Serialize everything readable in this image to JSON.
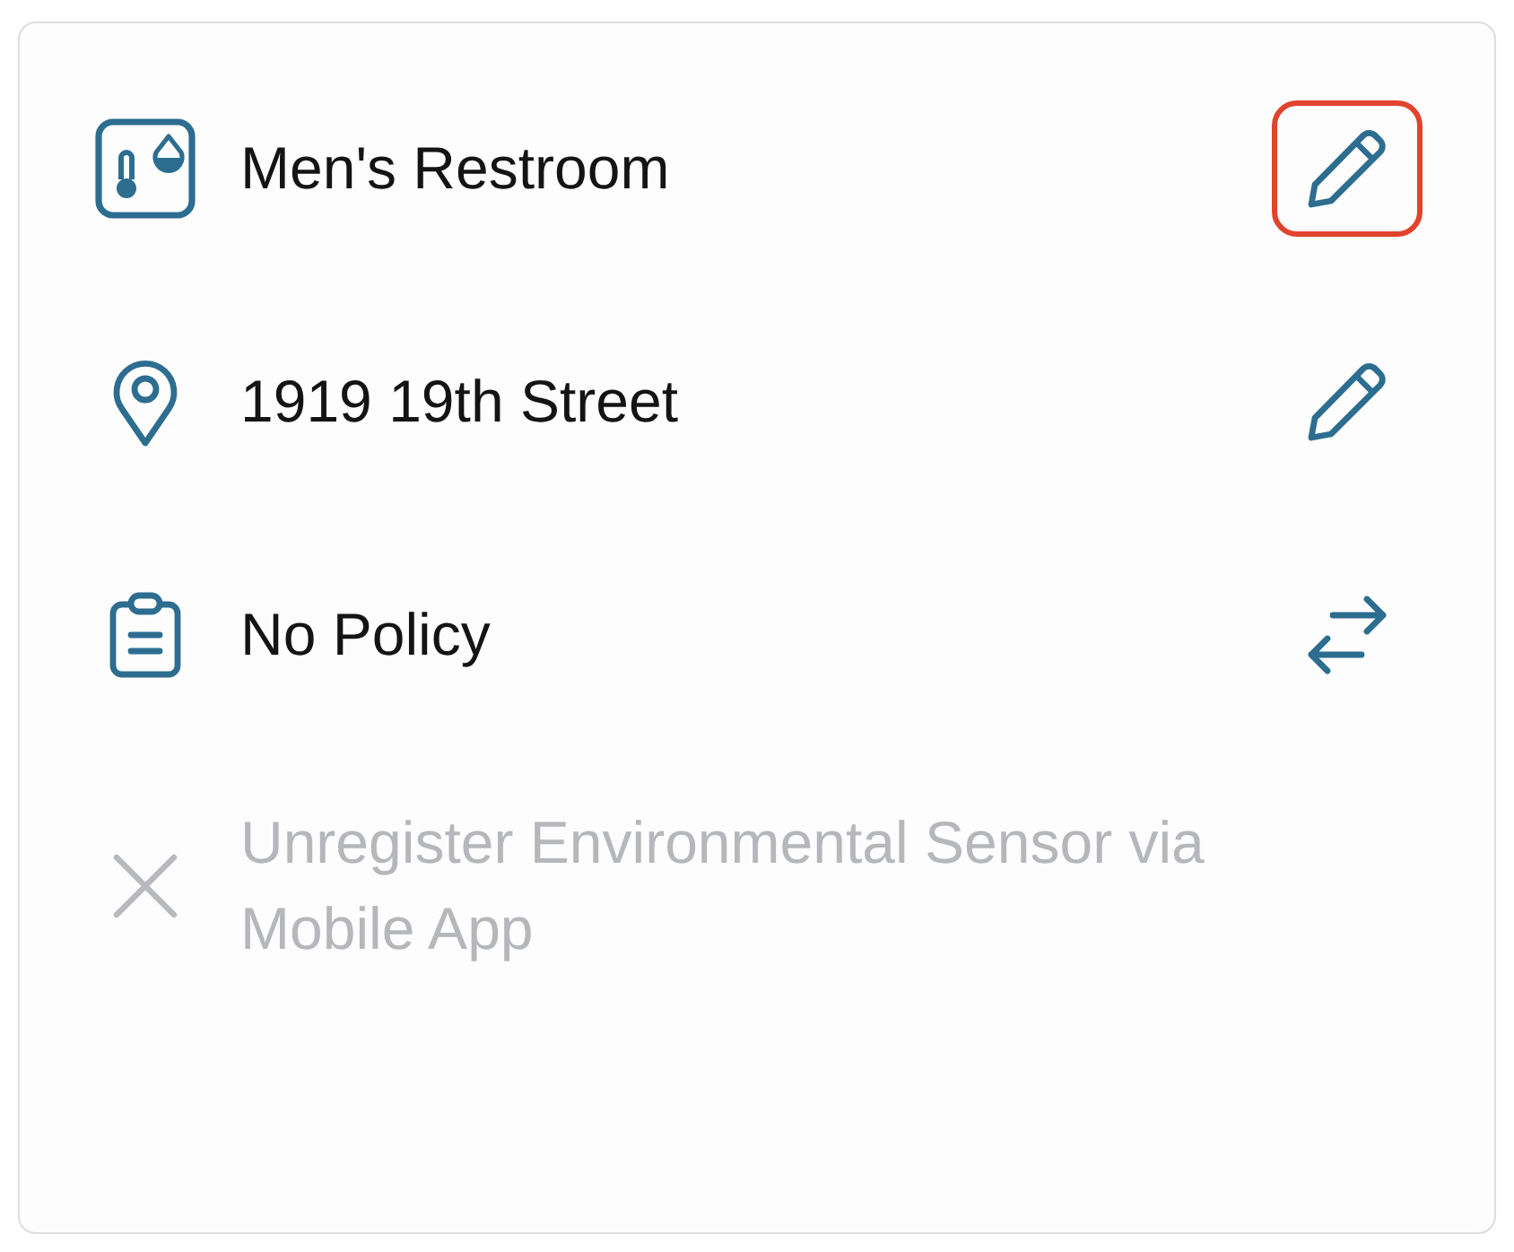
{
  "card": {
    "rows": [
      {
        "kind": "sensor",
        "label": "Men's Restroom",
        "disabled": false,
        "action": {
          "kind": "edit",
          "highlighted": true
        }
      },
      {
        "kind": "location",
        "label": "1919 19th Street",
        "disabled": false,
        "action": {
          "kind": "edit",
          "highlighted": false
        }
      },
      {
        "kind": "policy",
        "label": "No Policy",
        "disabled": false,
        "action": {
          "kind": "swap",
          "highlighted": false
        }
      },
      {
        "kind": "unregister",
        "label": "Unregister Environmental Sensor via Mobile App",
        "disabled": true
      }
    ]
  }
}
